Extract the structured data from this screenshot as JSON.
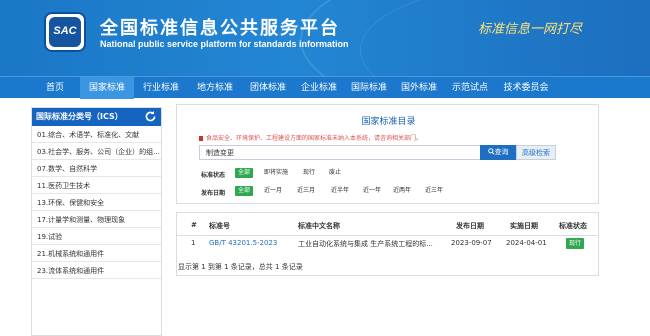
{
  "header": {
    "logo_text": "SAC",
    "title": "全国标准信息公共服务平台",
    "subtitle": "National public service platform  for standards information",
    "slogan": "标准信息一网打尽"
  },
  "nav": {
    "items": [
      "首页",
      "国家标准",
      "行业标准",
      "地方标准",
      "团体标准",
      "企业标准",
      "国际标准",
      "国外标准",
      "示范试点",
      "技术委员会"
    ],
    "active": "国家标准"
  },
  "sidebar": {
    "title": "国际标准分类号（ICS）",
    "items": [
      "01.综合、术语学、标准化、文献",
      "03.社会学、服务、公司（企业）的组...",
      "07.数学、自然科学",
      "11.医药卫生技术",
      "13.环保、保健和安全",
      "17.计量学和测量、物理现象",
      "19.试验",
      "21.机械系统和通用件",
      "23.流体系统和通用件"
    ]
  },
  "catalog": {
    "title": "国家标准目录",
    "notice": "食品安全、环境保护、工程建设方面的国家标准未纳入本系统，请咨询相关部门。",
    "search_value": "制造变更",
    "search_button": "查询",
    "advanced_button": "高级检索",
    "status_filter": {
      "label": "标准状态",
      "options": [
        "全部",
        "即将实施",
        "现行",
        "废止"
      ],
      "selected": "全部"
    },
    "date_filter": {
      "label": "发布日期",
      "options": [
        "全部",
        "近一月",
        "近三月",
        "近半年",
        "近一年",
        "近两年",
        "近三年"
      ],
      "selected": "全部"
    }
  },
  "results": {
    "headers": [
      "#",
      "标准号",
      "标准中文名称",
      "发布日期",
      "实施日期",
      "标准状态"
    ],
    "rows": [
      {
        "index": "1",
        "code": "GB/T 43201.5-2023",
        "name": "工业自动化系统与集成 生产系统工程的标...",
        "publish_date": "2023-09-07",
        "effective_date": "2024-04-01",
        "status": "现行"
      }
    ],
    "summary": "显示第 1 到第 1 条记录，总共 1 条记录"
  },
  "colors": {
    "header_blue": "#1a77c6",
    "nav_blue": "#1b78cc",
    "active_green": "#2fa84f",
    "link_blue": "#1e6fc2",
    "notice_red": "#d9534f"
  }
}
